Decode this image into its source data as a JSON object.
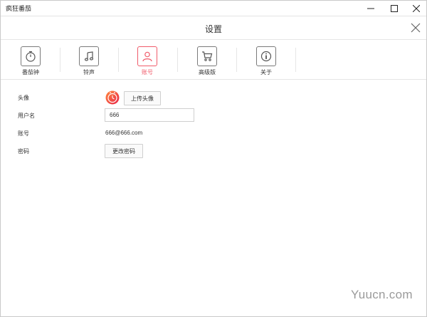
{
  "window": {
    "title": "疯狂番茄"
  },
  "dialog": {
    "title": "设置"
  },
  "tabs": [
    {
      "label": "番茄钟",
      "icon": "stopwatch-icon",
      "active": false
    },
    {
      "label": "铃声",
      "icon": "music-note-icon",
      "active": false
    },
    {
      "label": "账号",
      "icon": "user-icon",
      "active": true
    },
    {
      "label": "高级版",
      "icon": "cart-icon",
      "active": false
    },
    {
      "label": "关于",
      "icon": "info-icon",
      "active": false
    }
  ],
  "colors": {
    "accent": "#f05b6a",
    "border": "#cfcfcf",
    "icon_border": "#7a7a7a"
  },
  "account": {
    "avatar_label": "头像",
    "upload_avatar_button": "上传头像",
    "username_label": "用户名",
    "username_value": "666",
    "account_label": "账号",
    "account_value": "666@666.com",
    "password_label": "密码",
    "change_password_button": "更改密码"
  },
  "watermark": "Yuucn.com"
}
